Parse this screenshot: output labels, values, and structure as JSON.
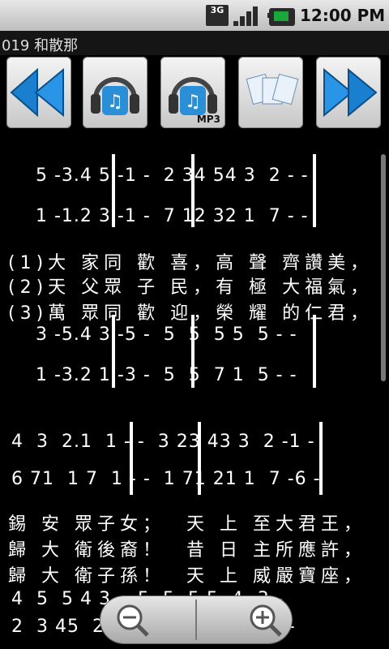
{
  "status": {
    "network": "3G",
    "time": "12:00 PM"
  },
  "title": "019 和散那",
  "toolbar": {
    "prev": "previous-song",
    "play": "play-audio",
    "mp3": "MP3",
    "sheet": "sheet-music",
    "next": "next-song"
  },
  "score": {
    "row1_notes": "5 -3.4 5 -1 -  2 34 54 3  2 - -",
    "row2_notes": "1 -1.2 3 -1 -  7 12 32 1  7 - -",
    "lyrics1": "(1)大 家同 歡 喜，高 聲 齊讚美，",
    "lyrics2": "(2)天 父眾 子 民，有 極 大福氣，",
    "lyrics3": "(3)萬 眾同 歡 迎，榮 耀 的仁君，",
    "row3_notes": "3 -5.4 3 -5 -  5  5  5 5  5 - -",
    "row4_notes": "1 -3.2 1 -3 -  5  5  7 1  5 - -",
    "row5_notes": "4  3  2.1  1 - -  3 23 43 3  2 -1 -",
    "row6_notes": "6 71  1 7  1 - -  1 71 21 1  7 -6 -",
    "lyrics4": "錫 安 眾子女；  天 上 至大君王，",
    "lyrics5": "歸 大 衛後裔！  昔 日 主所應許，",
    "lyrics6": "歸 大 衛子孫！  天 上 威嚴寶座，",
    "row7_notes": "4  5  5 4 3 -  5  5  5 5  4 -3 -",
    "row8_notes": "2  3 45  2 1 -  1  1  1 1  5 -6 -"
  },
  "zoom": {
    "out": "zoom-out",
    "in": "zoom-in"
  }
}
